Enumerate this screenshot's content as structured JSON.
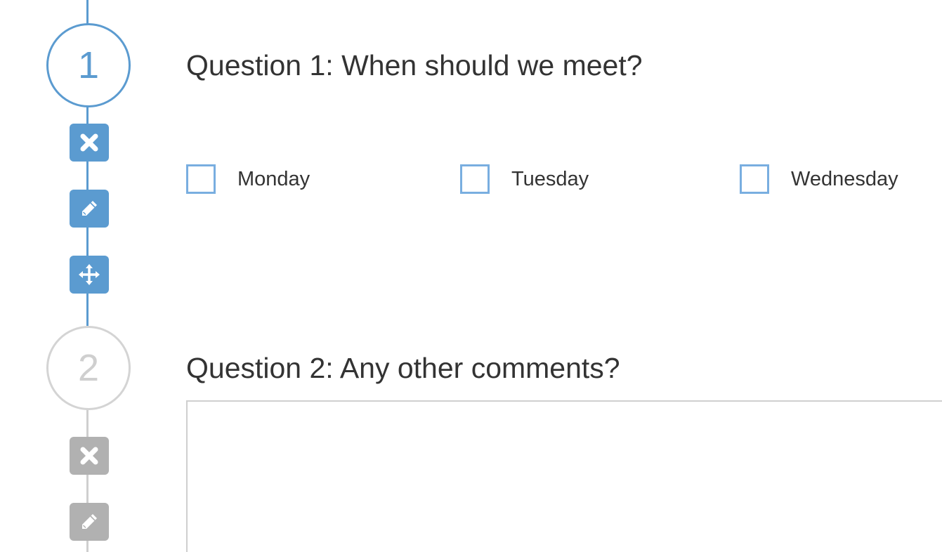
{
  "steps": [
    {
      "number": "1",
      "state": "active"
    },
    {
      "number": "2",
      "state": "inactive"
    }
  ],
  "question1": {
    "title": "Question 1: When should we meet?",
    "options": [
      "Monday",
      "Tuesday",
      "Wednesday"
    ]
  },
  "question2": {
    "title": "Question 2: Any other comments?",
    "comment_value": ""
  },
  "icons": {
    "delete": "times-icon",
    "edit": "pencil-icon",
    "move": "arrows-move-icon"
  },
  "colors": {
    "accent": "#5b9bd0",
    "checkbox_border": "#79aee0",
    "inactive": "#b1b1b1",
    "text": "#333333"
  }
}
